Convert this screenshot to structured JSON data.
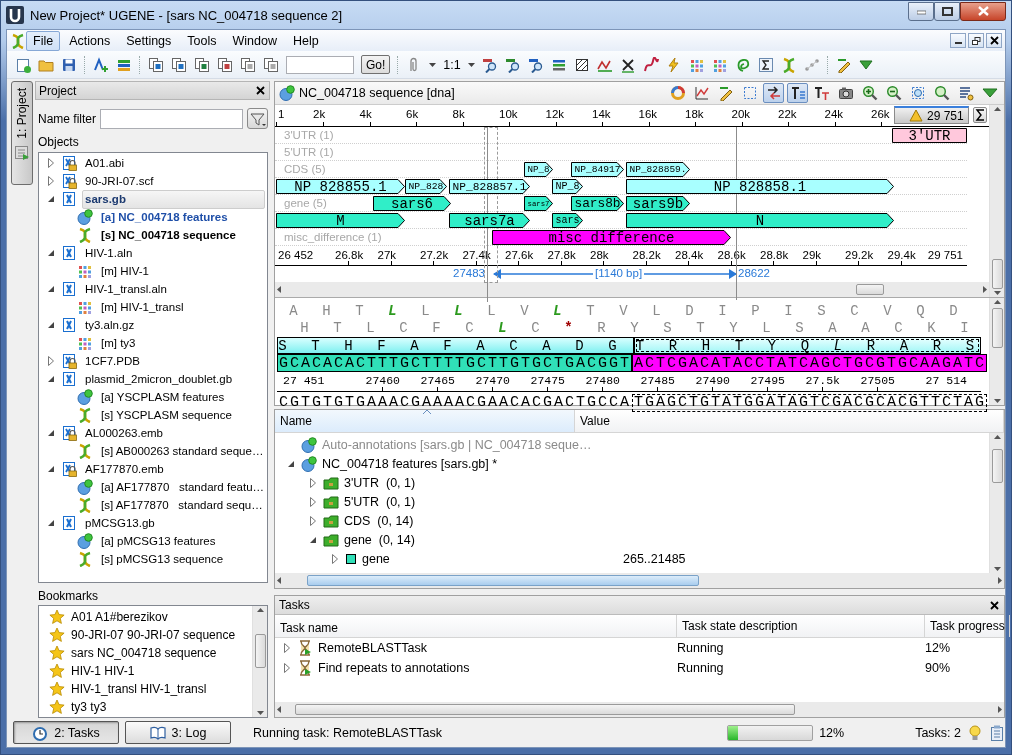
{
  "window": {
    "title": "New Project* UGENE - [sars NC_004718 sequence 2]"
  },
  "menu": [
    {
      "label": "File",
      "selected": true
    },
    {
      "label": "Actions",
      "selected": false
    },
    {
      "label": "Settings",
      "selected": false
    },
    {
      "label": "Tools",
      "selected": false
    },
    {
      "label": "Window",
      "selected": false
    },
    {
      "label": "Help",
      "selected": false
    }
  ],
  "toolbar": {
    "go_button": "Go!",
    "zoom_label": "1:1"
  },
  "side_tabs": [
    {
      "label": "1: Project",
      "selected": true
    }
  ],
  "project": {
    "title": "Project",
    "filter_label": "Name filter",
    "objects_label": "Objects",
    "items": [
      {
        "label": "A01.abi",
        "kind": "locked_document",
        "expanded": false,
        "selected": false
      },
      {
        "label": "90-JRI-07.scf",
        "kind": "locked_document",
        "expanded": false,
        "selected": false
      },
      {
        "label": "sars.gb",
        "kind": "document",
        "expanded": true,
        "selected": true,
        "children": [
          {
            "label": "[a] NC_004718 features",
            "kind": "annotation_object",
            "active": true,
            "focused": true,
            "selected": false
          },
          {
            "label": "[s] NC_004718 sequence",
            "kind": "sequence_object",
            "active": true,
            "focused": false,
            "selected": false
          }
        ]
      },
      {
        "label": "HIV-1.aln",
        "kind": "document",
        "expanded": true,
        "selected": false,
        "children": [
          {
            "label": "[m] HIV-1",
            "kind": "alignment_object",
            "active": false,
            "focused": false,
            "selected": false
          }
        ]
      },
      {
        "label": "HIV-1_transl.aln",
        "kind": "document",
        "expanded": true,
        "selected": false,
        "children": [
          {
            "label": "[m] HIV-1_transl",
            "kind": "alignment_object",
            "active": false,
            "focused": false,
            "selected": false
          }
        ]
      },
      {
        "label": "ty3.aln.gz",
        "kind": "document",
        "expanded": true,
        "selected": false,
        "children": [
          {
            "label": "[m] ty3",
            "kind": "alignment_object",
            "active": false,
            "focused": false,
            "selected": false
          }
        ]
      },
      {
        "label": "1CF7.PDB",
        "kind": "locked_document",
        "expanded": false,
        "selected": false
      },
      {
        "label": "plasmid_2micron_doublet.gb",
        "kind": "document",
        "expanded": true,
        "selected": false,
        "children": [
          {
            "label": "[a] YSCPLASM features",
            "kind": "annotation_object",
            "active": false,
            "focused": false,
            "selected": false
          },
          {
            "label": "[s] YSCPLASM sequence",
            "kind": "sequence_object",
            "active": false,
            "focused": false,
            "selected": false
          }
        ]
      },
      {
        "label": "AL000263.emb",
        "kind": "locked_document",
        "expanded": true,
        "selected": false,
        "children": [
          {
            "label": "[s] AB000263 standard seque…",
            "kind": "sequence_object",
            "active": false,
            "focused": false,
            "selected": false
          }
        ]
      },
      {
        "label": "AF177870.emb",
        "kind": "locked_document",
        "expanded": true,
        "selected": false,
        "children": [
          {
            "label": "[a] AF177870   standard featu…",
            "kind": "annotation_object",
            "active": false,
            "focused": false,
            "selected": false
          },
          {
            "label": "[s] AF177870   standard sequ…",
            "kind": "sequence_object",
            "active": false,
            "focused": false,
            "selected": false
          }
        ]
      },
      {
        "label": "pMCSG13.gb",
        "kind": "document",
        "expanded": true,
        "selected": false,
        "children": [
          {
            "label": "[a] pMCSG13 features",
            "kind": "annotation_object",
            "active": false,
            "focused": false,
            "selected": false
          },
          {
            "label": "[s] pMCSG13 sequence",
            "kind": "sequence_object",
            "active": false,
            "focused": false,
            "selected": false
          }
        ]
      }
    ]
  },
  "bookmarks": {
    "title": "Bookmarks",
    "items": [
      {
        "label": "A01 A1#berezikov"
      },
      {
        "label": "90-JRI-07 90-JRI-07 sequence"
      },
      {
        "label": "sars NC_004718 sequence"
      },
      {
        "label": "HIV-1 HIV-1"
      },
      {
        "label": "HIV-1_transl HIV-1_transl"
      },
      {
        "label": "ty3 ty3"
      }
    ]
  },
  "sequence_view": {
    "title": "NC_004718 sequence [dna]",
    "tools": [
      {
        "pressed": false
      },
      {
        "pressed": false
      },
      {
        "pressed": false
      },
      {
        "pressed": false
      },
      {
        "pressed": true
      },
      {
        "pressed": true
      },
      {
        "pressed": false
      },
      {
        "pressed": false
      },
      {
        "pressed": false
      },
      {
        "pressed": false
      },
      {
        "pressed": false
      },
      {
        "pressed": false
      },
      {
        "pressed": false
      },
      {
        "pressed": false
      }
    ],
    "overview_ticks": [
      "1",
      "2k",
      "4k",
      "6k",
      "8k",
      "10k",
      "12k",
      "14k",
      "16k",
      "18k",
      "20k",
      "22k",
      "24k",
      "26k"
    ],
    "overview_end": "29 751",
    "tracks": [
      {
        "label": "3'UTR (1)",
        "annotations": [
          {
            "label": "3'UTR",
            "color": "#ffc8dc"
          }
        ]
      },
      {
        "label": "5'UTR (1)"
      },
      {
        "label": "CDS (5)",
        "annotations": [
          {
            "label": "NP_8",
            "color": "#a8ffff"
          },
          {
            "label": "NP_84917",
            "color": "#a8ffff"
          },
          {
            "label": "NP_828859.",
            "color": "#a8ffff"
          }
        ]
      },
      {
        "annotations": [
          {
            "label": "NP 828855.1",
            "color": "#a8ffff"
          },
          {
            "label": "NP_828",
            "color": "#a8ffff"
          },
          {
            "label": "NP_828857.1",
            "color": "#a8ffff"
          },
          {
            "label": "NP_8",
            "color": "#a8ffff"
          },
          {
            "label": "NP 828858.1",
            "color": "#a8ffff"
          }
        ]
      },
      {
        "label": "gene (5)",
        "annotations": [
          {
            "label": "sars6",
            "color": "#30eec8"
          },
          {
            "label": "sars7",
            "color": "#30eec8"
          },
          {
            "label": "sars8b",
            "color": "#30eec8"
          },
          {
            "label": "sars9b",
            "color": "#30eec8"
          }
        ]
      },
      {
        "annotations": [
          {
            "label": "M",
            "color": "#30eec8"
          },
          {
            "label": "sars7a",
            "color": "#30eec8"
          },
          {
            "label": "sars",
            "color": "#30eec8"
          },
          {
            "label": "N",
            "color": "#30eec8"
          }
        ]
      },
      {
        "label": "misc_difference (1)",
        "annotations": [
          {
            "label": "misc difference",
            "color": "#ff00ff"
          }
        ]
      }
    ],
    "detail_start": "26 452",
    "detail_ticks": [
      "26.8k",
      "27k",
      "27.2k",
      "27.4k",
      "27.6k",
      "27.8k",
      "28k",
      "28.2k",
      "28.4k",
      "28.6k",
      "28.8k",
      "29k",
      "29.2k",
      "29.4k"
    ],
    "detail_end": "29 751",
    "selection": {
      "start": "27483",
      "length": "[1140 bp]",
      "end": "28622"
    },
    "frames": [
      [
        {
          "letter": "A",
          "kind": "plain"
        },
        {
          "letter": "H",
          "kind": "plain"
        },
        {
          "letter": "T",
          "kind": "plain"
        },
        {
          "letter": "L",
          "kind": "start"
        },
        {
          "letter": "L",
          "kind": "plain"
        },
        {
          "letter": "L",
          "kind": "start"
        },
        {
          "letter": "L",
          "kind": "plain"
        },
        {
          "letter": "V",
          "kind": "plain"
        },
        {
          "letter": "L",
          "kind": "start"
        },
        {
          "letter": "T",
          "kind": "plain"
        },
        {
          "letter": "V",
          "kind": "plain"
        },
        {
          "letter": "L",
          "kind": "plain"
        },
        {
          "letter": "D",
          "kind": "plain"
        },
        {
          "letter": "I",
          "kind": "plain"
        },
        {
          "letter": "P",
          "kind": "plain"
        },
        {
          "letter": "I",
          "kind": "plain"
        },
        {
          "letter": "S",
          "kind": "plain"
        },
        {
          "letter": "C",
          "kind": "plain"
        },
        {
          "letter": "V",
          "kind": "plain"
        },
        {
          "letter": "Q",
          "kind": "plain"
        },
        {
          "letter": "D",
          "kind": "plain"
        }
      ],
      [
        {
          "letter": "H",
          "kind": "plain"
        },
        {
          "letter": "T",
          "kind": "plain"
        },
        {
          "letter": "L",
          "kind": "plain"
        },
        {
          "letter": "C",
          "kind": "plain"
        },
        {
          "letter": "F",
          "kind": "plain"
        },
        {
          "letter": "C",
          "kind": "plain"
        },
        {
          "letter": "L",
          "kind": "start"
        },
        {
          "letter": "C",
          "kind": "plain"
        },
        {
          "letter": "*",
          "kind": "stop"
        },
        {
          "letter": "R",
          "kind": "plain"
        },
        {
          "letter": "Y",
          "kind": "plain"
        },
        {
          "letter": "S",
          "kind": "plain"
        },
        {
          "letter": "T",
          "kind": "plain"
        },
        {
          "letter": "Y",
          "kind": "plain"
        },
        {
          "letter": "L",
          "kind": "plain"
        },
        {
          "letter": "S",
          "kind": "plain"
        },
        {
          "letter": "A",
          "kind": "plain"
        },
        {
          "letter": "A",
          "kind": "plain"
        },
        {
          "letter": "C",
          "kind": "plain"
        },
        {
          "letter": "K",
          "kind": "plain"
        },
        {
          "letter": "I",
          "kind": "plain"
        }
      ]
    ],
    "annotation_translation": [
      {
        "selected": false,
        "letters": [
          {
            "letter": "S",
            "kind": "plain"
          },
          {
            "letter": "T",
            "kind": "plain"
          },
          {
            "letter": "H",
            "kind": "plain"
          },
          {
            "letter": "F",
            "kind": "plain"
          },
          {
            "letter": "A",
            "kind": "plain"
          },
          {
            "letter": "F",
            "kind": "plain"
          },
          {
            "letter": "A",
            "kind": "plain"
          },
          {
            "letter": "C",
            "kind": "plain"
          },
          {
            "letter": "A",
            "kind": "plain"
          },
          {
            "letter": "D",
            "kind": "plain"
          },
          {
            "letter": "G",
            "kind": "plain"
          }
        ]
      },
      {
        "selected": true,
        "letters": [
          {
            "letter": "T",
            "kind": "plain"
          },
          {
            "letter": "R",
            "kind": "plain"
          },
          {
            "letter": "H",
            "kind": "plain"
          },
          {
            "letter": "T",
            "kind": "plain"
          },
          {
            "letter": "Y",
            "kind": "plain"
          },
          {
            "letter": "Q",
            "kind": "plain"
          },
          {
            "letter": "L",
            "kind": "italic"
          },
          {
            "letter": "R",
            "kind": "plain"
          },
          {
            "letter": "A",
            "kind": "plain"
          },
          {
            "letter": "R",
            "kind": "plain"
          },
          {
            "letter": "S",
            "kind": "plain"
          }
        ]
      }
    ],
    "sequence": [
      {
        "text": "GCACACACTTTGCTTTTGCTTGTGCTGACGGT",
        "color": "#30e0b8"
      },
      {
        "text": "ACTCGACATACCTATCAGCTGCGTGCAAGATC",
        "color": "#ff00ff"
      }
    ],
    "ruler": [
      "27 451",
      "27460",
      "27465",
      "27470",
      "27475",
      "27480",
      "27485",
      "27490",
      "27495",
      "27.5k",
      "27505",
      "27 514"
    ],
    "complement": [
      {
        "text": "CGTGTGTGAAACGAAAACGAACACGACTGCCA",
        "selected": false
      },
      {
        "text": "TGAGCTGTATGGATAGTCGACGCACGTTCTAG",
        "selected": true
      }
    ]
  },
  "annotations_tree": {
    "columns": [
      "Name",
      "Value"
    ],
    "rows": [
      {
        "label": "Auto-annotations [sars.gb | NC_004718 seque…",
        "kind": "object",
        "dimmed": true
      },
      {
        "label": "NC_004718 features [sars.gb] *",
        "kind": "object",
        "dimmed": false,
        "expanded": true,
        "children": [
          {
            "label": "3'UTR  (0, 1)",
            "kind": "group",
            "expanded": false
          },
          {
            "label": "5'UTR  (0, 1)",
            "kind": "group",
            "expanded": false
          },
          {
            "label": "CDS  (0, 14)",
            "kind": "group",
            "expanded": false
          },
          {
            "label": "gene  (0, 14)",
            "kind": "group",
            "expanded": true,
            "children": [
              {
                "label": "gene",
                "kind": "annotation",
                "value": "265..21485",
                "expanded": false
              }
            ]
          }
        ]
      }
    ]
  },
  "tasks": {
    "title": "Tasks",
    "columns": [
      "Task name",
      "Task state description",
      "Task progress"
    ],
    "rows": [
      {
        "name": "RemoteBLASTTask",
        "state": "Running",
        "progress": "12%",
        "expanded": false
      },
      {
        "name": "Find repeats to annotations",
        "state": "Running",
        "progress": "90%",
        "expanded": false
      }
    ]
  },
  "status_bar": {
    "buttons": [
      {
        "label": "2: Tasks",
        "selected": true
      },
      {
        "label": "3: Log",
        "selected": false
      }
    ],
    "message": "Running task: RemoteBLASTTask",
    "progress": {
      "level": 0.12,
      "label": "12%"
    },
    "tasks_count": "Tasks: 2"
  }
}
